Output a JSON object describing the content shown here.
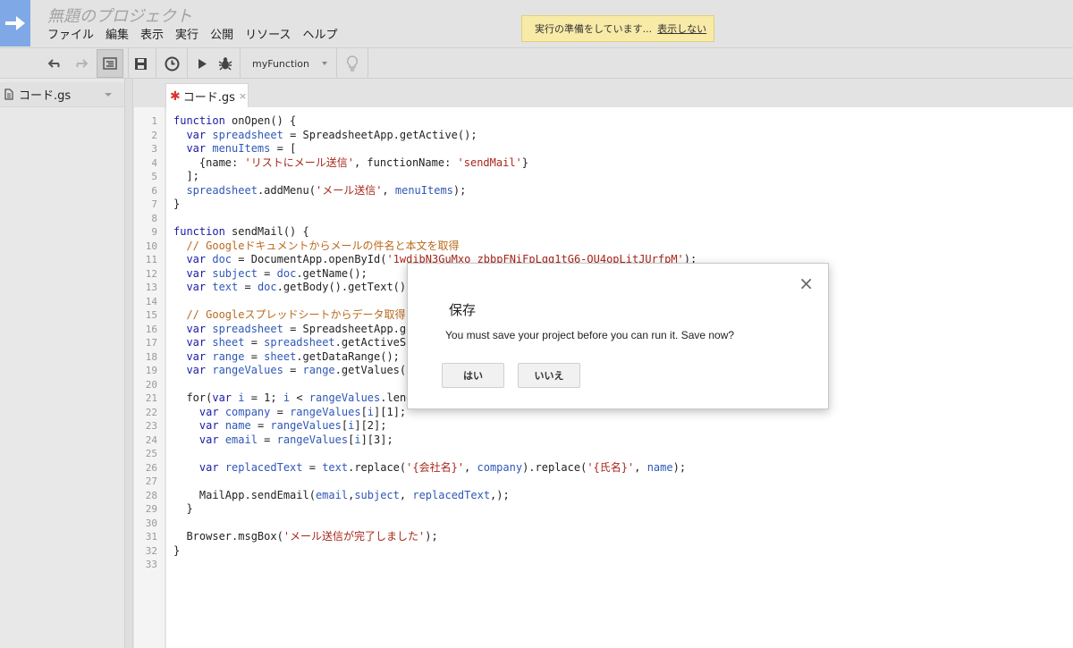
{
  "app": {
    "title": "無題のプロジェクト",
    "menu": [
      "ファイル",
      "編集",
      "表示",
      "実行",
      "公開",
      "リソース",
      "ヘルプ"
    ]
  },
  "notice": {
    "text": "実行の準備をしています...",
    "link": "表示しない"
  },
  "toolbar": {
    "function_select": "myFunction",
    "icons": [
      "undo-icon",
      "redo-icon",
      "indent-icon",
      "save-icon",
      "triggers-icon",
      "run-icon",
      "debug-icon",
      "lightbulb-icon"
    ]
  },
  "sidebar": {
    "file_name": "コード.gs"
  },
  "editor": {
    "tab_label": "コード.gs",
    "modified_marker": "✱",
    "tab_close": "×",
    "line_numbers": [
      "1",
      "2",
      "3",
      "4",
      "5",
      "6",
      "7",
      "8",
      "9",
      "10",
      "11",
      "12",
      "13",
      "14",
      "15",
      "16",
      "17",
      "18",
      "19",
      "20",
      "21",
      "22",
      "23",
      "24",
      "25",
      "26",
      "27",
      "28",
      "29",
      "30",
      "31",
      "32",
      "33"
    ],
    "lines": [
      [
        [
          "kw",
          "function "
        ],
        [
          "pl",
          "onOpen() {"
        ]
      ],
      [
        [
          "pl",
          "  "
        ],
        [
          "kw",
          "var "
        ],
        [
          "var",
          "spreadsheet"
        ],
        [
          "pl",
          " = SpreadsheetApp.getActive();"
        ]
      ],
      [
        [
          "pl",
          "  "
        ],
        [
          "kw",
          "var "
        ],
        [
          "var",
          "menuItems"
        ],
        [
          "pl",
          " = ["
        ]
      ],
      [
        [
          "pl",
          "    {name: "
        ],
        [
          "str",
          "'リストにメール送信'"
        ],
        [
          "pl",
          ", functionName: "
        ],
        [
          "str",
          "'sendMail'"
        ],
        [
          "pl",
          "}"
        ]
      ],
      [
        [
          "pl",
          "  ];"
        ]
      ],
      [
        [
          "pl",
          "  "
        ],
        [
          "var",
          "spreadsheet"
        ],
        [
          "pl",
          ".addMenu("
        ],
        [
          "str",
          "'メール送信'"
        ],
        [
          "pl",
          ", "
        ],
        [
          "var",
          "menuItems"
        ],
        [
          "pl",
          ");"
        ]
      ],
      [
        [
          "pl",
          "}"
        ]
      ],
      [],
      [
        [
          "kw",
          "function "
        ],
        [
          "pl",
          "sendMail() {"
        ]
      ],
      [
        [
          "cm",
          "  // Googleドキュメントからメールの件名と本文を取得"
        ]
      ],
      [
        [
          "pl",
          "  "
        ],
        [
          "kw",
          "var "
        ],
        [
          "var",
          "doc"
        ],
        [
          "pl",
          " = DocumentApp.openById("
        ],
        [
          "str",
          "'1wdibN3GuMxo_zbbpFNiFpLgg1tG6-OU4opLitJUrfpM'"
        ],
        [
          "pl",
          ");"
        ]
      ],
      [
        [
          "pl",
          "  "
        ],
        [
          "kw",
          "var "
        ],
        [
          "var",
          "subject"
        ],
        [
          "pl",
          " = "
        ],
        [
          "var",
          "doc"
        ],
        [
          "pl",
          ".getName();"
        ]
      ],
      [
        [
          "pl",
          "  "
        ],
        [
          "kw",
          "var "
        ],
        [
          "var",
          "text"
        ],
        [
          "pl",
          " = "
        ],
        [
          "var",
          "doc"
        ],
        [
          "pl",
          ".getBody().getText();"
        ]
      ],
      [],
      [
        [
          "cm",
          "  // Googleスプレッドシートからデータ取得"
        ]
      ],
      [
        [
          "pl",
          "  "
        ],
        [
          "kw",
          "var "
        ],
        [
          "var",
          "spreadsheet"
        ],
        [
          "pl",
          " = SpreadsheetApp.getActive();"
        ]
      ],
      [
        [
          "pl",
          "  "
        ],
        [
          "kw",
          "var "
        ],
        [
          "var",
          "sheet"
        ],
        [
          "pl",
          " = "
        ],
        [
          "var",
          "spreadsheet"
        ],
        [
          "pl",
          ".getActiveSheet();"
        ]
      ],
      [
        [
          "pl",
          "  "
        ],
        [
          "kw",
          "var "
        ],
        [
          "var",
          "range"
        ],
        [
          "pl",
          " = "
        ],
        [
          "var",
          "sheet"
        ],
        [
          "pl",
          ".getDataRange();"
        ]
      ],
      [
        [
          "pl",
          "  "
        ],
        [
          "kw",
          "var "
        ],
        [
          "var",
          "rangeValues"
        ],
        [
          "pl",
          " = "
        ],
        [
          "var",
          "range"
        ],
        [
          "pl",
          ".getValues();"
        ]
      ],
      [],
      [
        [
          "pl",
          "  for("
        ],
        [
          "kw",
          "var "
        ],
        [
          "var",
          "i"
        ],
        [
          "pl",
          " = 1; "
        ],
        [
          "var",
          "i"
        ],
        [
          "pl",
          " < "
        ],
        [
          "var",
          "rangeValues"
        ],
        [
          "pl",
          ".length; "
        ],
        [
          "var",
          "i"
        ],
        [
          "pl",
          "++) {"
        ]
      ],
      [
        [
          "pl",
          "    "
        ],
        [
          "kw",
          "var "
        ],
        [
          "var",
          "company"
        ],
        [
          "pl",
          " = "
        ],
        [
          "var",
          "rangeValues"
        ],
        [
          "pl",
          "["
        ],
        [
          "var",
          "i"
        ],
        [
          "pl",
          "][1];"
        ]
      ],
      [
        [
          "pl",
          "    "
        ],
        [
          "kw",
          "var "
        ],
        [
          "var",
          "name"
        ],
        [
          "pl",
          " = "
        ],
        [
          "var",
          "rangeValues"
        ],
        [
          "pl",
          "["
        ],
        [
          "var",
          "i"
        ],
        [
          "pl",
          "][2];"
        ]
      ],
      [
        [
          "pl",
          "    "
        ],
        [
          "kw",
          "var "
        ],
        [
          "var",
          "email"
        ],
        [
          "pl",
          " = "
        ],
        [
          "var",
          "rangeValues"
        ],
        [
          "pl",
          "["
        ],
        [
          "var",
          "i"
        ],
        [
          "pl",
          "][3];"
        ]
      ],
      [],
      [
        [
          "pl",
          "    "
        ],
        [
          "kw",
          "var "
        ],
        [
          "var",
          "replacedText"
        ],
        [
          "pl",
          " = "
        ],
        [
          "var",
          "text"
        ],
        [
          "pl",
          ".replace("
        ],
        [
          "str",
          "'{会社名}'"
        ],
        [
          "pl",
          ", "
        ],
        [
          "var",
          "company"
        ],
        [
          "pl",
          ").replace("
        ],
        [
          "str",
          "'{氏名}'"
        ],
        [
          "pl",
          ", "
        ],
        [
          "var",
          "name"
        ],
        [
          "pl",
          ");"
        ]
      ],
      [],
      [
        [
          "pl",
          "    MailApp.sendEmail("
        ],
        [
          "var",
          "email"
        ],
        [
          "pl",
          ","
        ],
        [
          "var",
          "subject"
        ],
        [
          "pl",
          ", "
        ],
        [
          "var",
          "replacedText"
        ],
        [
          "pl",
          ",);"
        ]
      ],
      [
        [
          "pl",
          "  }"
        ]
      ],
      [],
      [
        [
          "pl",
          "  Browser.msgBox("
        ],
        [
          "str",
          "'メール送信が完了しました'"
        ],
        [
          "pl",
          ");"
        ]
      ],
      [
        [
          "pl",
          "}"
        ]
      ],
      []
    ]
  },
  "dialog": {
    "title": "保存",
    "message": "You must save your project before you can run it. Save now?",
    "yes_label": "はい",
    "no_label": "いいえ",
    "close_symbol": "×"
  }
}
